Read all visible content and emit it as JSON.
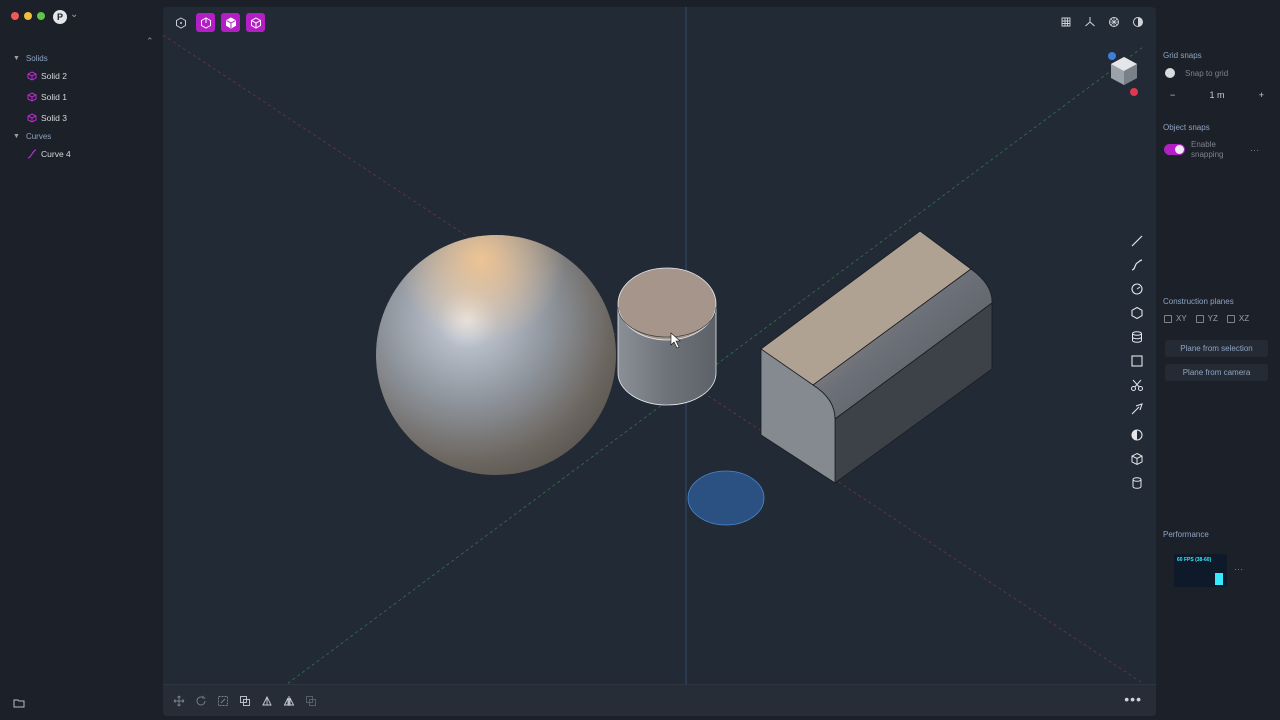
{
  "sidebar": {
    "groups": [
      {
        "label": "Solids",
        "items": [
          "Solid 2",
          "Solid 1",
          "Solid 3"
        ]
      },
      {
        "label": "Curves",
        "items": [
          "Curve 4"
        ]
      }
    ]
  },
  "app": {
    "badge": "P"
  },
  "right_panel": {
    "grid_snaps": {
      "title": "Grid snaps",
      "snap_label": "Snap to grid",
      "size_value": "1 m",
      "decrement": "−",
      "increment": "+"
    },
    "object_snaps": {
      "title": "Object snaps",
      "toggle_label": "Enable snapping",
      "enabled": true
    },
    "construction_planes": {
      "title": "Construction planes",
      "planes": [
        "XY",
        "YZ",
        "XZ"
      ],
      "from_selection": "Plane from selection",
      "from_camera": "Plane from camera"
    },
    "performance": {
      "title": "Performance",
      "fps_label": "60 FPS (38-60)"
    }
  },
  "viewport": {
    "more_label": "•••"
  },
  "colors": {
    "accent": "#b31fc4",
    "x_axis": "#c84a5a",
    "y_axis": "#3e8f5e",
    "z_axis": "#4a7ab8",
    "fps": "#37e8ff"
  }
}
